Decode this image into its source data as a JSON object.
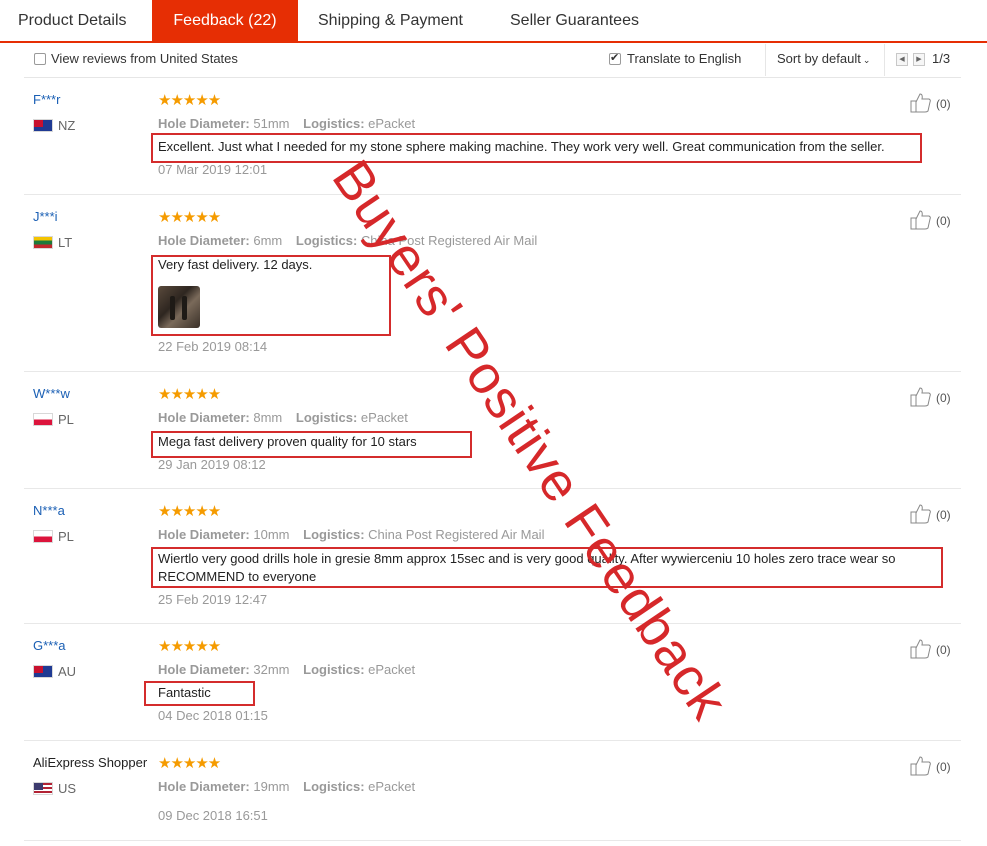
{
  "tabs": [
    {
      "label": "Product Details"
    },
    {
      "label": "Feedback (22)"
    },
    {
      "label": "Shipping & Payment"
    },
    {
      "label": "Seller Guarantees"
    }
  ],
  "filter": {
    "view_us_label": "View reviews from United States",
    "view_us_checked": false,
    "translate_label": "Translate to English",
    "translate_checked": true,
    "sort_label": "Sort by default",
    "page_text": "1/3"
  },
  "labels": {
    "hole_diameter": "Hole Diameter:",
    "logistics": "Logistics:"
  },
  "stars_glyph": "★★★★★",
  "reviews": [
    {
      "name": "F***r",
      "country": "NZ",
      "flag": "nz",
      "rating": 5,
      "hole": "51mm",
      "logistics": "ePacket",
      "text": "Excellent. Just what I needed for my stone sphere making machine. They work very well. Great communication from the seller.",
      "date": "07 Mar 2019 12:01",
      "likes": "(0)"
    },
    {
      "name": "J***i",
      "country": "LT",
      "flag": "lt",
      "rating": 5,
      "hole": "6mm",
      "logistics": "China Post Registered Air Mail",
      "text": "Very fast delivery. 12 days.",
      "date": "22 Feb 2019 08:14",
      "likes": "(0)",
      "has_photo": true
    },
    {
      "name": "W***w",
      "country": "PL",
      "flag": "pl",
      "rating": 5,
      "hole": "8mm",
      "logistics": "ePacket",
      "text": "Mega fast delivery proven quality for 10 stars",
      "date": "29 Jan 2019 08:12",
      "likes": "(0)"
    },
    {
      "name": "N***a",
      "country": "PL",
      "flag": "pl",
      "rating": 5,
      "hole": "10mm",
      "logistics": "China Post Registered Air Mail",
      "text": "Wiertlo very good drills hole in gresie 8mm approx 15sec and is very good quality. After wywierceniu 10 holes zero trace wear so RECOMMEND to everyone",
      "date": "25 Feb 2019 12:47",
      "likes": "(0)"
    },
    {
      "name": "G***a",
      "country": "AU",
      "flag": "au",
      "rating": 5,
      "hole": "32mm",
      "logistics": "ePacket",
      "text": "Fantastic",
      "date": "04 Dec 2018 01:15",
      "likes": "(0)"
    },
    {
      "name": "AliExpress Shopper",
      "country": "US",
      "flag": "us",
      "rating": 5,
      "hole": "19mm",
      "logistics": "ePacket",
      "text": "",
      "date": "09 Dec 2018 16:51",
      "likes": "(0)"
    }
  ],
  "overlay_text": "Buyers' Positive Feedback",
  "colors": {
    "accent": "#e62e04",
    "star": "#f59b00",
    "highlight_box": "#d42c2c",
    "username": "#1a5fb4"
  }
}
